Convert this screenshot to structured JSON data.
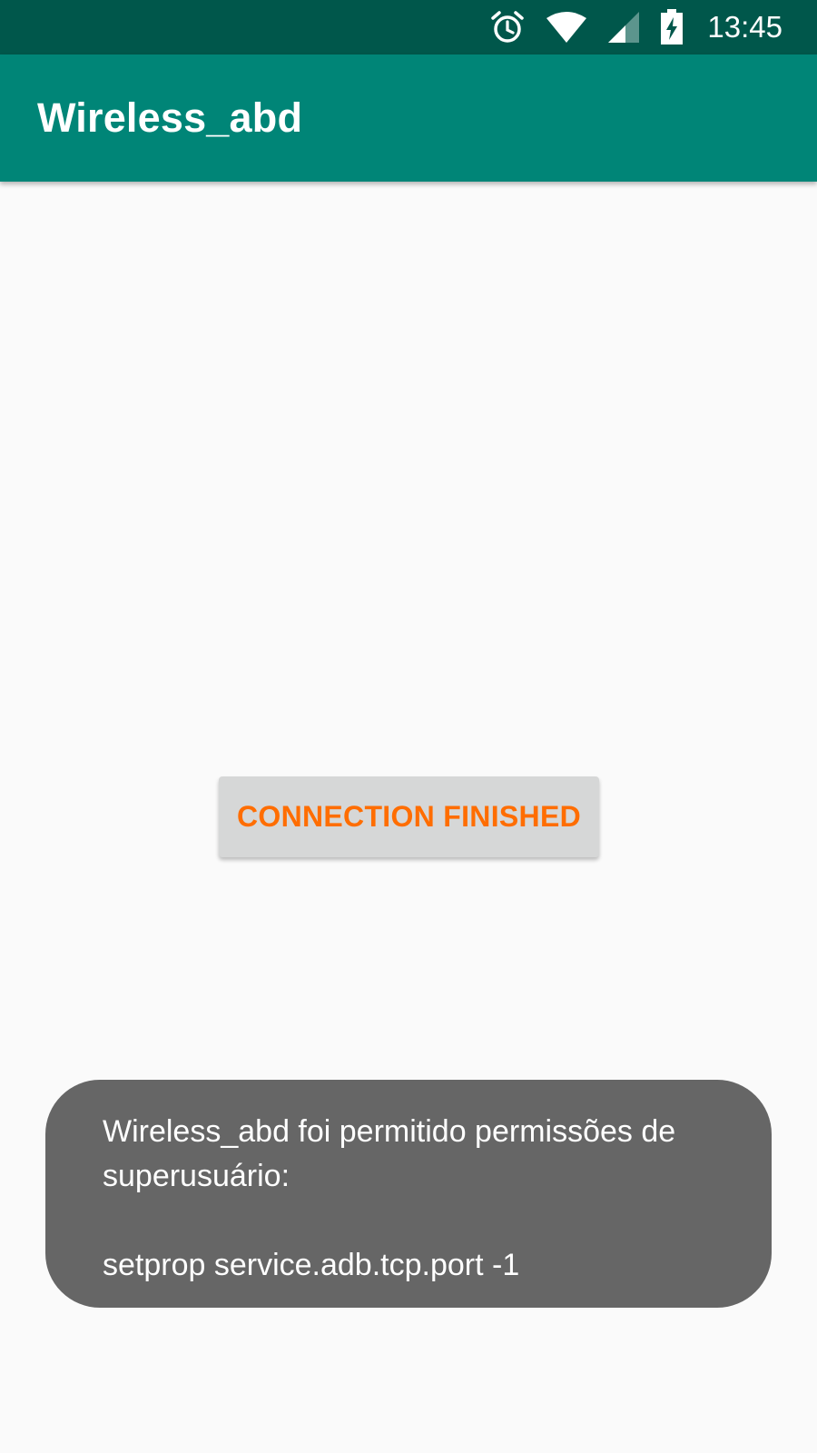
{
  "status_bar": {
    "time": "13:45",
    "icons": [
      "alarm-icon",
      "wifi-icon",
      "cell-signal-icon",
      "battery-charging-icon"
    ]
  },
  "app_bar": {
    "title": "Wireless_abd"
  },
  "main": {
    "button_label": "CONNECTION FINISHED"
  },
  "toast": {
    "line1": "Wireless_abd foi permitido permissões de",
    "line2": "superusuário:",
    "line3": "setprop service.adb.tcp.port -1"
  },
  "colors": {
    "status_bar": "#00574b",
    "app_bar": "#008577",
    "button_text": "#ff6d00",
    "button_bg": "#d6d7d7",
    "toast_bg": "#666666",
    "background": "#fafafa"
  }
}
